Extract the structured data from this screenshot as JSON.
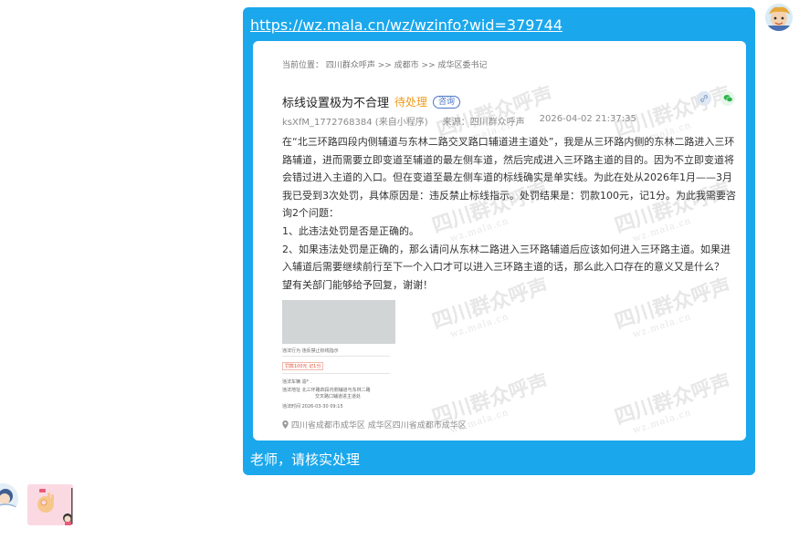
{
  "message": {
    "link_text": "https://wz.mala.cn/wz/wzinfo?wid=379744",
    "caption": "老师，请核实处理",
    "bubble_color": "#1aa7ec"
  },
  "screenshot_card": {
    "breadcrumb": "当前位置： 四川群众呼声 >> 成都市 >> 成华区委书记",
    "title": "标线设置极为不合理",
    "status": "待处理",
    "tag": "咨询",
    "meta": {
      "author": "ksXfM_1772768384 (来自小程序)",
      "source": "来源：四川群众呼声",
      "datetime": "2026-04-02 21:37:35"
    },
    "paragraphs": [
      "在“北三环路四段内侧辅道与东林二路交叉路口辅道进主道处”，我是从三环路内侧的东林二路进入三环路辅道，进而需要立即变道至辅道的最左侧车道，然后完成进入三环路主道的目的。因为不立即变道将会错过进入主道的入口。但在变道至最左侧车道的标线确实是单实线。为此在处从2026年1月——3月我已受到3次处罚，具体原因是：违反禁止标线指示。处罚结果是：罚款100元，记1分。为此我需要咨询2个问题：",
      "1、此违法处罚是否是正确的。",
      "2、如果违法处罚是正确的，那么请问从东林二路进入三环路辅道后应该如何进入三环路主道。如果进入辅道后需要继续前行至下一个入口才可以进入三环路主道的话，那么此入口存在的意义又是什么？",
      "望有关部门能够给予回复，谢谢！"
    ],
    "attachment": {
      "line1": "违法行为  违反禁止标线指示",
      "line2": "罚款100元 记1分",
      "line3": "违法车辆  渝*  .",
      "line4": "违法地址  北三环路四段内侧辅道与东林二路",
      "line5": "交叉路口辅道进主道处",
      "line6": "违法时间  2026-03-30 09:15"
    },
    "location": "四川省成都市成华区 成华区四川省成都市成华区",
    "watermark": "四川群众呼声",
    "watermark_sub": "wz.mala.cn"
  },
  "icons": {
    "location": "location-pin-icon",
    "share_link": "link-icon",
    "share_wechat": "wechat-icon"
  }
}
